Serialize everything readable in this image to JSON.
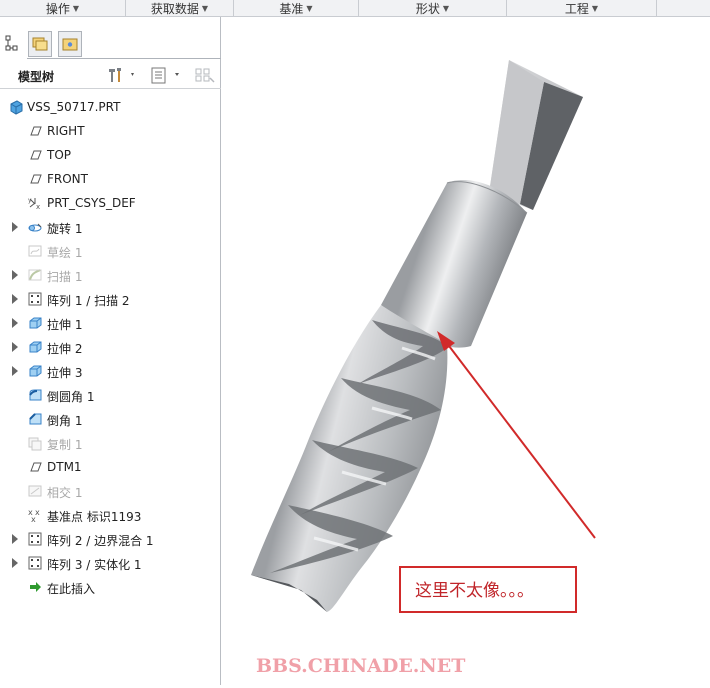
{
  "menu": {
    "items": [
      {
        "label": "操作"
      },
      {
        "label": "获取数据"
      },
      {
        "label": "基准"
      },
      {
        "label": "形状"
      },
      {
        "label": "工程"
      }
    ]
  },
  "panel": {
    "title": "模型树",
    "tabs": [
      "model-tree",
      "layers",
      "favorites"
    ]
  },
  "tree": {
    "items": [
      {
        "label": "VSS_50717.PRT",
        "icon": "part-icon",
        "expandable": false,
        "dim": false
      },
      {
        "label": "RIGHT",
        "icon": "datum-plane-icon",
        "expandable": false,
        "dim": false
      },
      {
        "label": "TOP",
        "icon": "datum-plane-icon",
        "expandable": false,
        "dim": false
      },
      {
        "label": "FRONT",
        "icon": "datum-plane-icon",
        "expandable": false,
        "dim": false
      },
      {
        "label": "PRT_CSYS_DEF",
        "icon": "csys-icon",
        "expandable": false,
        "dim": false
      },
      {
        "label": "旋转 1",
        "icon": "revolve-icon",
        "expandable": true,
        "dim": false
      },
      {
        "label": "草绘 1",
        "icon": "sketch-icon",
        "expandable": false,
        "dim": true
      },
      {
        "label": "扫描 1",
        "icon": "sweep-icon",
        "expandable": true,
        "dim": true
      },
      {
        "label": "阵列 1 / 扫描 2",
        "icon": "pattern-icon",
        "expandable": true,
        "dim": false
      },
      {
        "label": "拉伸 1",
        "icon": "extrude-icon",
        "expandable": true,
        "dim": false
      },
      {
        "label": "拉伸 2",
        "icon": "extrude-icon",
        "expandable": true,
        "dim": false
      },
      {
        "label": "拉伸 3",
        "icon": "extrude-icon",
        "expandable": true,
        "dim": false
      },
      {
        "label": "倒圆角 1",
        "icon": "round-icon",
        "expandable": false,
        "dim": false
      },
      {
        "label": "倒角 1",
        "icon": "chamfer-icon",
        "expandable": false,
        "dim": false
      },
      {
        "label": "复制 1",
        "icon": "copy-icon",
        "expandable": false,
        "dim": true
      },
      {
        "label": "DTM1",
        "icon": "datum-plane-icon",
        "expandable": false,
        "dim": false
      },
      {
        "label": "相交 1",
        "icon": "intersect-icon",
        "expandable": false,
        "dim": true
      },
      {
        "label": "基准点 标识1193",
        "icon": "datum-point-icon",
        "expandable": false,
        "dim": false
      },
      {
        "label": "阵列 2 / 边界混合 1",
        "icon": "pattern-icon",
        "expandable": true,
        "dim": false
      },
      {
        "label": "阵列 3 / 实体化 1",
        "icon": "pattern-icon",
        "expandable": true,
        "dim": false
      },
      {
        "label": "在此插入",
        "icon": "insert-here-icon",
        "expandable": false,
        "dim": false
      }
    ]
  },
  "annotation": {
    "note": "这里不太像。。。",
    "color": "#d12a2a"
  },
  "watermark": "BBS.CHINADE.NET",
  "colors": {
    "accent": "#d12a2a",
    "model": "#a9acb0"
  }
}
